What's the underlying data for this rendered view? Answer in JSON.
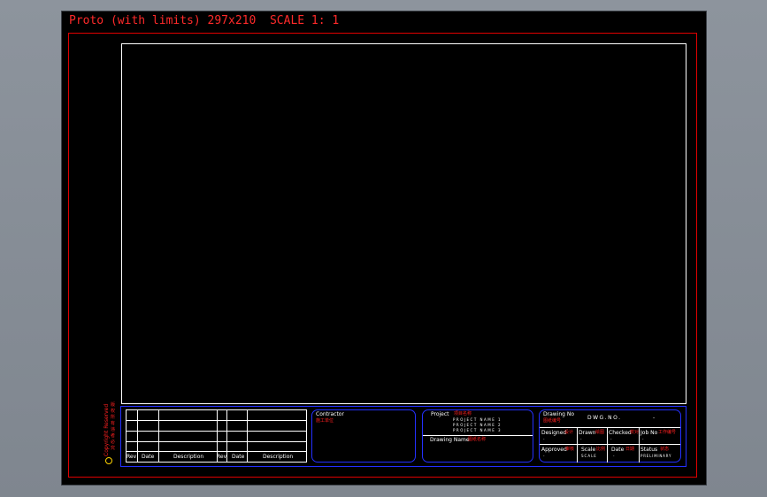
{
  "title": "Proto (with limits) 297x210  SCALE 1: 1",
  "side_vertical": "Copyright Reserved",
  "side_chars": [
    "版",
    "权",
    "所",
    "有",
    "违",
    "者",
    "必",
    "究"
  ],
  "revisions": {
    "rev": "Rev",
    "date": "Date",
    "description": "Description"
  },
  "contractor": {
    "label": "Contractor",
    "sub": "施工单位"
  },
  "project": {
    "label": "Project",
    "sub": "项目名称",
    "lines": [
      "PROJECT NAME 1",
      "PROJECT NAME 2",
      "PROJECT NAME 3"
    ]
  },
  "drawing_name": {
    "label": "Drawing Name",
    "sub": "图纸名称"
  },
  "drawing_no": {
    "label": "Drawing No",
    "sub": "图纸编号",
    "value": "DWG.NO.",
    "dash": "-"
  },
  "fields": {
    "designed": {
      "label": "Designed",
      "sub": "设计",
      "value": "-"
    },
    "drawn": {
      "label": "Drawn",
      "sub": "绘图",
      "value": "-"
    },
    "checked": {
      "label": "Checked",
      "sub": "校对",
      "value": "-"
    },
    "job_no": {
      "label": "Job No",
      "sub": "工作编号",
      "value": "-"
    },
    "approved": {
      "label": "Approved",
      "sub": "审核",
      "value": "-"
    },
    "scale": {
      "label": "Scale",
      "sub": "比例",
      "value": "SCALE"
    },
    "date": {
      "label": "Date",
      "sub": "日期",
      "value": "-"
    },
    "status": {
      "label": "Status",
      "sub": "状态",
      "value": "PRELIMINARY"
    }
  }
}
